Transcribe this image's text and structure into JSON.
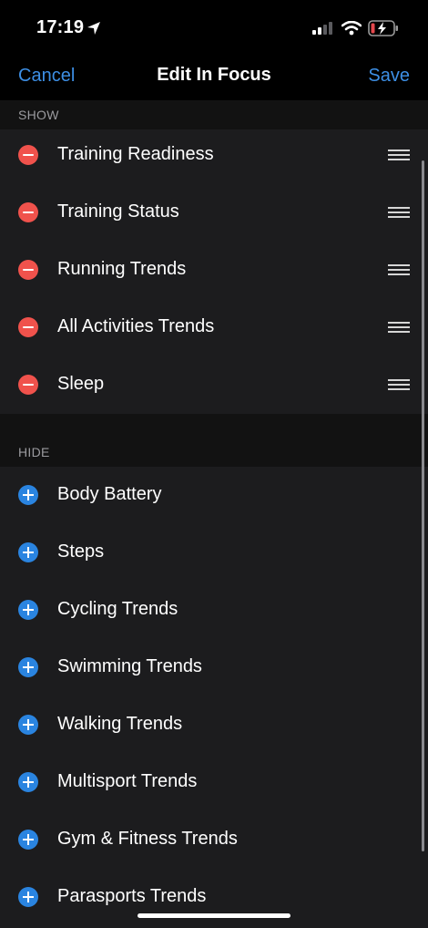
{
  "status_bar": {
    "time": "17:19",
    "icons": [
      "location-arrow-icon",
      "cellular-signal-icon",
      "wifi-icon",
      "battery-charging-icon"
    ]
  },
  "nav": {
    "cancel_label": "Cancel",
    "title": "Edit In Focus",
    "save_label": "Save"
  },
  "show_section": {
    "header": "SHOW",
    "items": [
      {
        "label": "Training Readiness"
      },
      {
        "label": "Training Status"
      },
      {
        "label": "Running Trends"
      },
      {
        "label": "All Activities Trends"
      },
      {
        "label": "Sleep"
      }
    ]
  },
  "hide_section": {
    "header": "HIDE",
    "items": [
      {
        "label": "Body Battery"
      },
      {
        "label": "Steps"
      },
      {
        "label": "Cycling Trends"
      },
      {
        "label": "Swimming Trends"
      },
      {
        "label": "Walking Trends"
      },
      {
        "label": "Multisport Trends"
      },
      {
        "label": "Gym & Fitness Trends"
      },
      {
        "label": "Parasports Trends"
      }
    ]
  },
  "colors": {
    "accent": "#3d8fe5",
    "remove": "#f0524c",
    "add": "#2a84e0",
    "row_background": "#1c1c1e",
    "section_background": "#121212"
  }
}
